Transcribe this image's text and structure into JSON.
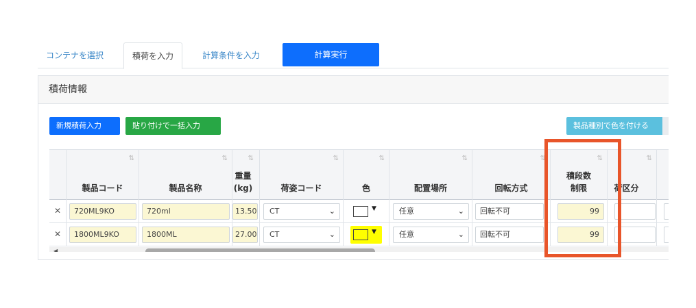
{
  "tabs": {
    "select_container": "コンテナを選択",
    "enter_cargo": "積荷を入力",
    "enter_conditions": "計算条件を入力",
    "run": "計算実行"
  },
  "card": {
    "title": "積荷情報",
    "new_cargo_button": "新規積荷入力",
    "paste_bulk_button": "貼り付けで一括入力",
    "color_by_type_button": "製品種別で色を付ける"
  },
  "table": {
    "sort_glyph": "⇅",
    "columns": {
      "code": "製品コード",
      "name": "製品名称",
      "weight_line1": "重量",
      "weight_line2": "(kg)",
      "package": "荷姿コード",
      "color": "色",
      "placement": "配置場所",
      "rotation": "回転方式",
      "stack_line1": "積段数",
      "stack_line2": "制限",
      "load_class": "荷区分"
    },
    "rows": [
      {
        "code": "720ML9KO",
        "name": "720ml",
        "weight": "13.50",
        "package": "CT",
        "color": "#ffffff",
        "placement": "任意",
        "rotation": "回転不可",
        "stack": "99"
      },
      {
        "code": "1800ML9KO",
        "name": "1800ML",
        "weight": "27.00",
        "package": "CT",
        "color": "#ffff00",
        "placement": "任意",
        "rotation": "回転不可",
        "stack": "99"
      }
    ]
  },
  "colors": {
    "primary": "#0d6efd",
    "success": "#28a745",
    "info": "#5bc0de",
    "highlight_border": "#e8552a",
    "input_bg": "#fbf7d3"
  }
}
